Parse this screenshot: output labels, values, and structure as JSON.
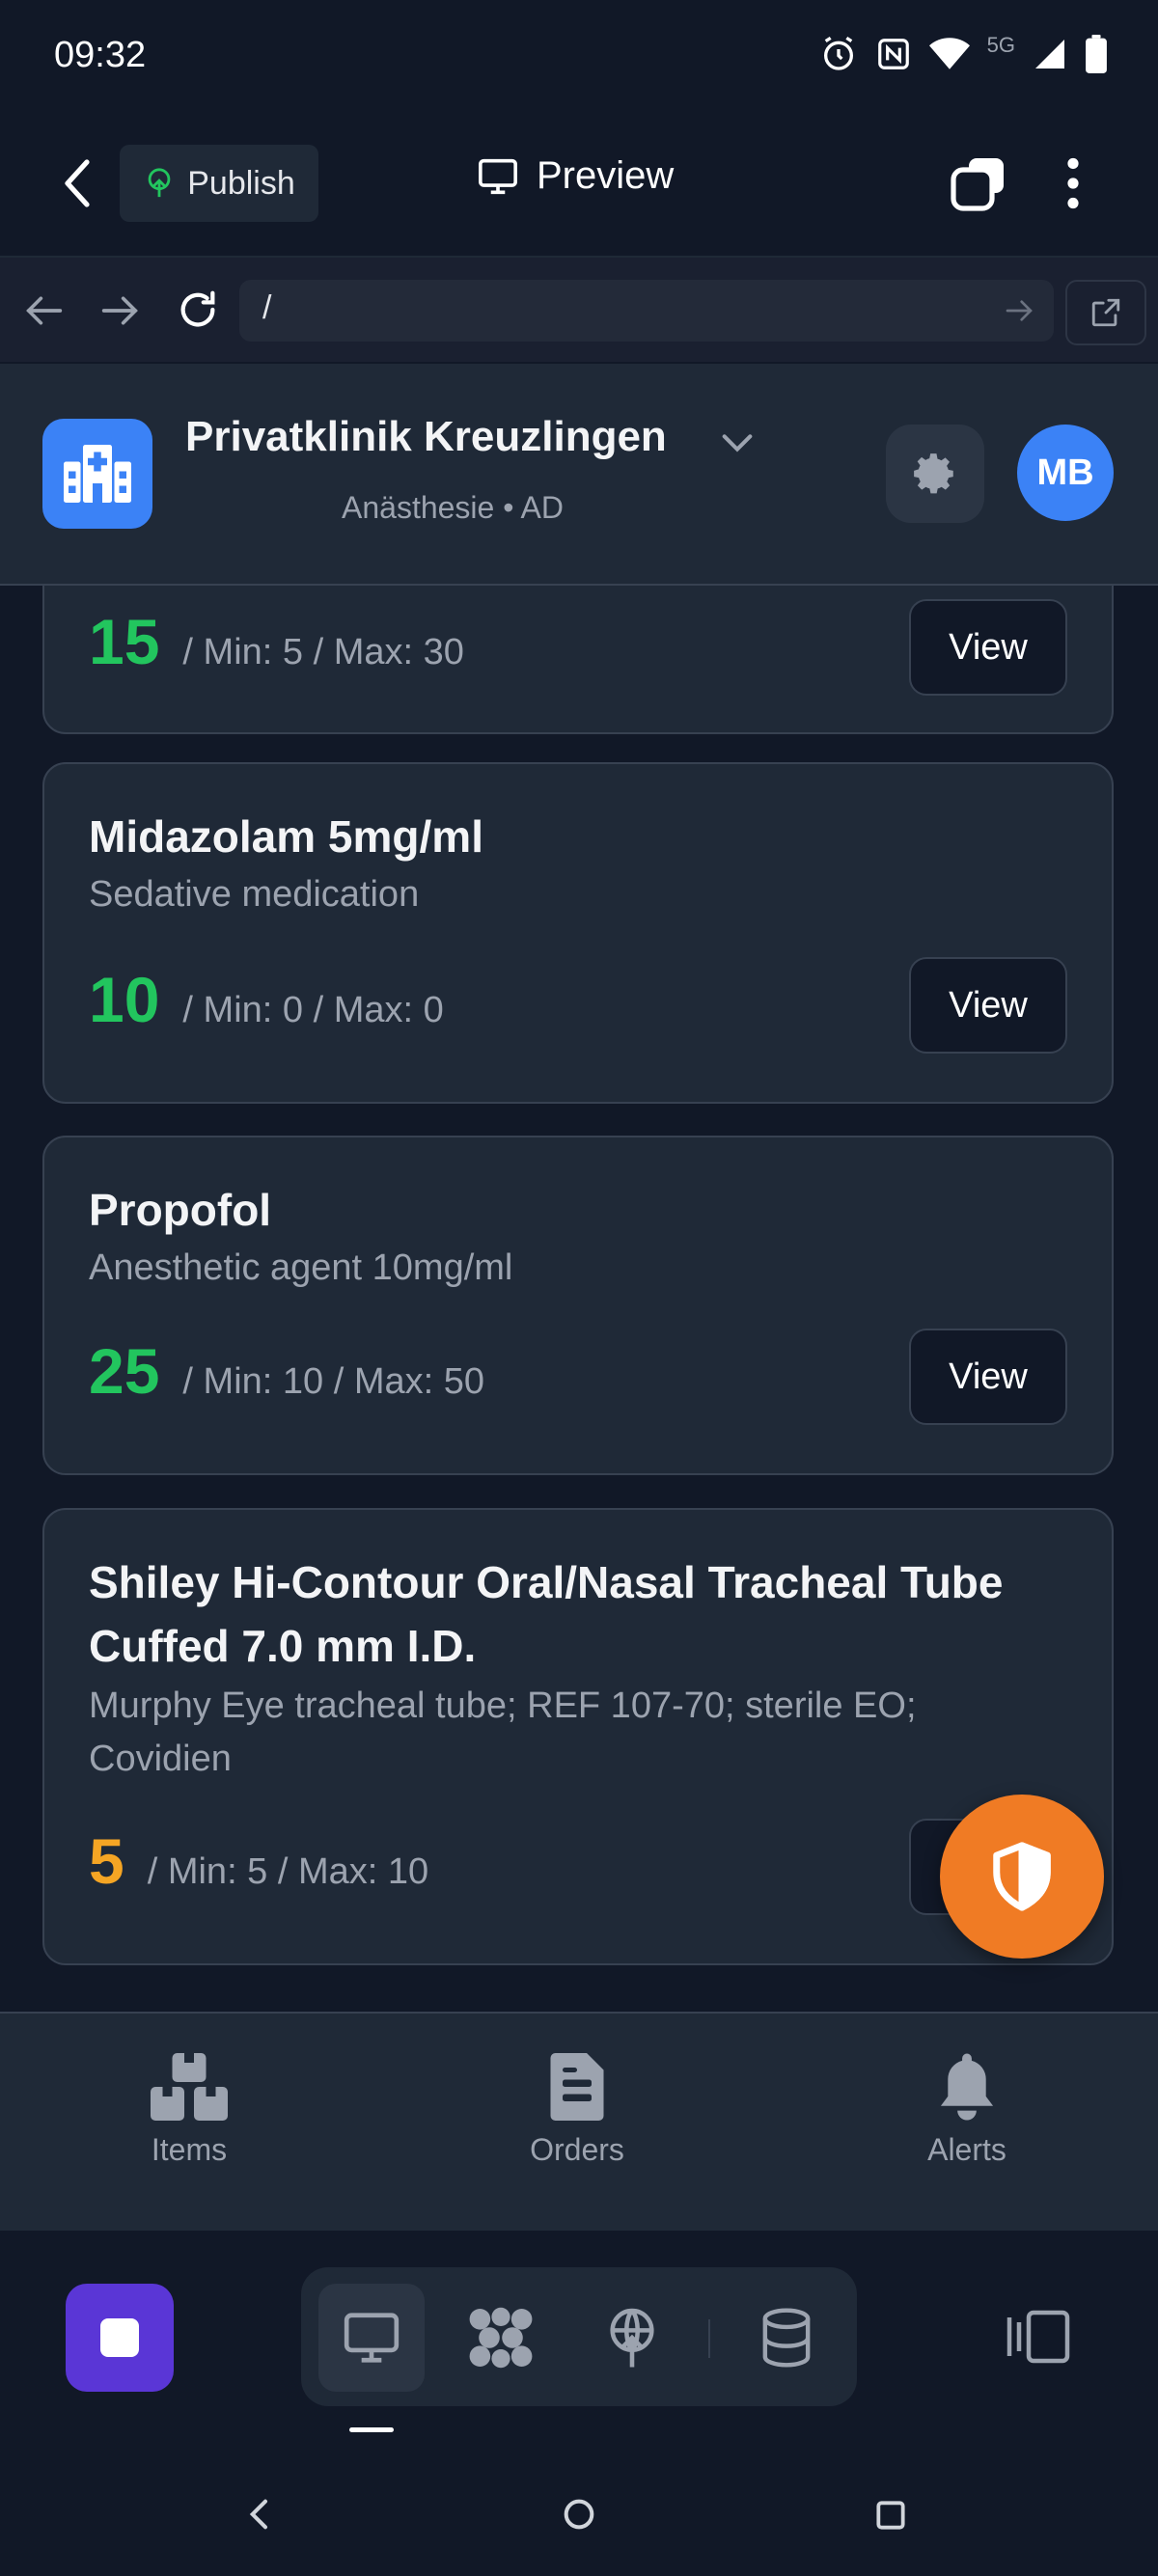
{
  "status_bar": {
    "time": "09:32",
    "network": "5G"
  },
  "toolbar": {
    "publish_label": "Publish",
    "preview_label": "Preview"
  },
  "url_bar": {
    "url": "/"
  },
  "clinic": {
    "name": "Privatklinik Kreuzlingen",
    "subtitle": "Anästhesie • AD",
    "avatar_initials": "MB"
  },
  "items": [
    {
      "name": "",
      "description": "",
      "quantity": "15",
      "min_max": "/ Min: 5 / Max: 30",
      "status_color": "#22c55e",
      "view_label": "View"
    },
    {
      "name": "Midazolam 5mg/ml",
      "description": "Sedative medication",
      "quantity": "10",
      "min_max": "/ Min: 0 / Max: 0",
      "status_color": "#22c55e",
      "view_label": "View"
    },
    {
      "name": "Propofol",
      "description": "Anesthetic agent 10mg/ml",
      "quantity": "25",
      "min_max": "/ Min: 10 / Max: 50",
      "status_color": "#22c55e",
      "view_label": "View"
    },
    {
      "name": "Shiley Hi-Contour Oral/Nasal Tracheal Tube Cuffed 7.0 mm I.D.",
      "description": "Murphy Eye tracheal tube; REF 107-70; sterile EO; Covidien",
      "quantity": "5",
      "min_max": "/ Min: 5 / Max: 10",
      "status_color": "#f5a524",
      "view_label": "View"
    }
  ],
  "tabs": [
    {
      "label": "Items",
      "icon": "boxes-icon"
    },
    {
      "label": "Orders",
      "icon": "document-icon"
    },
    {
      "label": "Alerts",
      "icon": "bell-icon"
    }
  ],
  "colors": {
    "accent": "#3b82f6",
    "fab": "#f07b24",
    "ok": "#22c55e",
    "warning": "#f5a524",
    "dock_app": "#5a36d6"
  }
}
